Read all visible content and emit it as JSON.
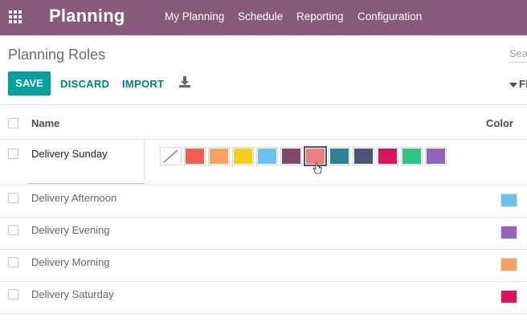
{
  "navbar": {
    "brand": "Planning",
    "menu": [
      "My Planning",
      "Schedule",
      "Reporting",
      "Configuration"
    ],
    "background": "#875a7b"
  },
  "control_panel": {
    "breadcrumb": "Planning Roles",
    "search_placeholder": "Search...",
    "buttons": {
      "save": "SAVE",
      "discard": "DISCARD",
      "import": "IMPORT"
    },
    "filter_label": "Filters"
  },
  "table": {
    "headers": {
      "name": "Name",
      "color": "Color"
    },
    "editing_row": {
      "name": "Delivery Sunday"
    },
    "palette": [
      {
        "name": "no-color",
        "color": "#ffffff"
      },
      {
        "name": "red",
        "color": "#f06050"
      },
      {
        "name": "orange",
        "color": "#f4a460"
      },
      {
        "name": "yellow",
        "color": "#f7cd1f"
      },
      {
        "name": "light-blue",
        "color": "#6cc1ed"
      },
      {
        "name": "dark-purple",
        "color": "#814968"
      },
      {
        "name": "salmon-pink",
        "color": "#eb7e7f"
      },
      {
        "name": "medium-blue",
        "color": "#2c8397"
      },
      {
        "name": "dark-blue",
        "color": "#475577"
      },
      {
        "name": "fuchsia",
        "color": "#d6145f"
      },
      {
        "name": "green",
        "color": "#30c381"
      },
      {
        "name": "purple",
        "color": "#9365b8"
      }
    ],
    "selected_palette": "salmon-pink",
    "rows": [
      {
        "name": "Delivery Afternoon",
        "color": "#6cc1ed"
      },
      {
        "name": "Delivery Evening",
        "color": "#9365b8"
      },
      {
        "name": "Delivery Morning",
        "color": "#f4a460"
      },
      {
        "name": "Delivery Saturday",
        "color": "#d6145f"
      }
    ]
  }
}
